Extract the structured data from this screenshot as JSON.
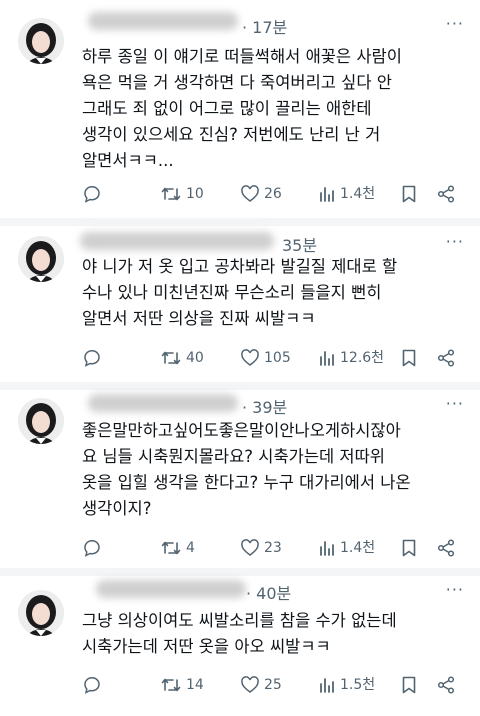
{
  "posts": [
    {
      "time": "· 17분",
      "more": "···",
      "text": "하루 종일 이 얘기로 떠들썩해서 애꽃은 사람이\n욕은 먹을 거 생각하면 다 죽여버리고 싶다 안\n그래도 죄 없이 어그로 많이 끌리는 애한테\n생각이 있으세요 진심? 저번에도 난리 난 거\n알면서ㅋㅋ...",
      "stats": {
        "reposts": "10",
        "likes": "26",
        "views": "1.4천"
      }
    },
    {
      "time": "35분",
      "more": "···",
      "text": "야 니가 저 옷 입고 공차봐라 발길질 제대로 할\n수나 있나 미친년진짜 무슨소리 들을지 뻔히\n알면서 저딴 의상을 진짜 씨발ㅋㅋ",
      "stats": {
        "reposts": "40",
        "likes": "105",
        "views": "12.6천"
      }
    },
    {
      "time": "· 39분",
      "more": "···",
      "text": "좋은말만하고싶어도좋은말이안나오게하시잖아\n요 님들 시축뭔지몰라요? 시축가는데 저따위\n옷을 입힐 생각을 한다고? 누구 대가리에서 나온\n생각이지?",
      "stats": {
        "reposts": "4",
        "likes": "23",
        "views": "1.4천"
      }
    },
    {
      "time": "· 40분",
      "more": "···",
      "text": "그냥 의상이여도 씨발소리를 참을 수가 없는데\n시축가는데 저딴 옷을 아오 씨발ㅋㅋ",
      "stats": {
        "reposts": "14",
        "likes": "25",
        "views": "1.5천"
      }
    }
  ],
  "colors": {
    "text": "#0f1419",
    "muted": "#536471",
    "divider": "#eff3f4"
  },
  "icons": [
    "reply-icon",
    "repost-icon",
    "like-icon",
    "views-icon",
    "bookmark-icon",
    "share-icon",
    "more-icon"
  ]
}
